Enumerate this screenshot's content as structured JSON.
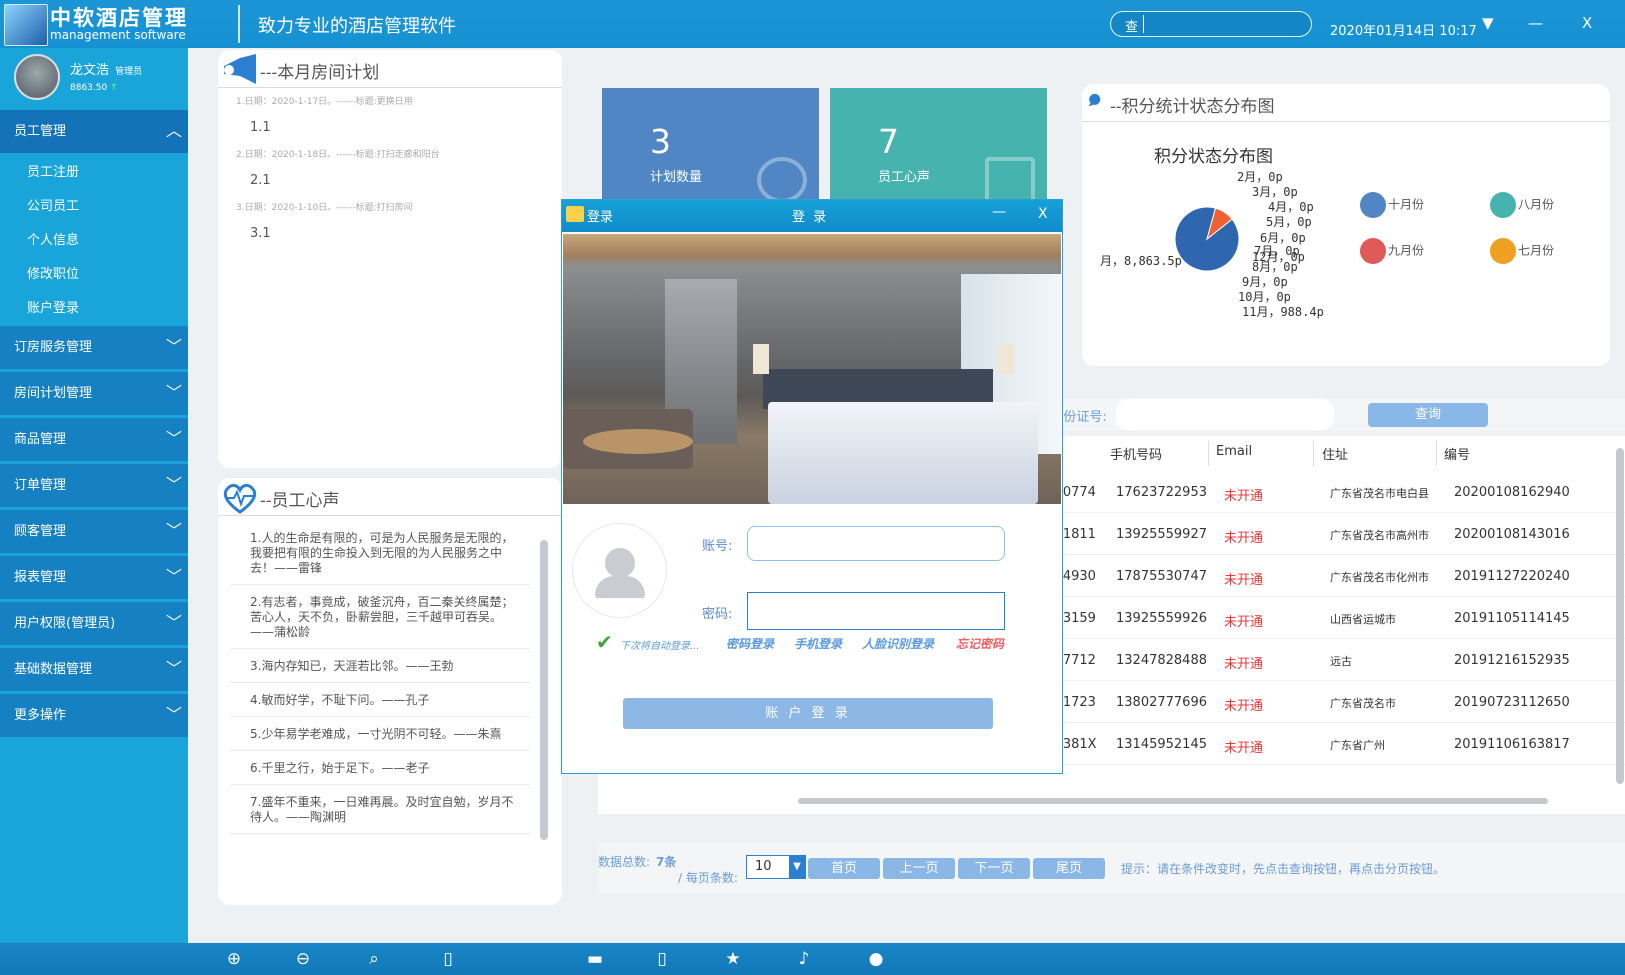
{
  "app": {
    "title": "中软酒店管理",
    "subtitle": "management software",
    "slogan": "致力专业的酒店管理软件"
  },
  "search": {
    "label": "查",
    "placeholder": ""
  },
  "datetime": "2020年01月14日 10:17",
  "window_controls": {
    "dropdown": "▼",
    "minimize": "—",
    "close": "X"
  },
  "user": {
    "name": "龙文浩",
    "role": "管理员",
    "balance": "8863.50",
    "trend": "↑"
  },
  "menu": [
    {
      "label": "员工管理",
      "open": true,
      "children": [
        "员工注册",
        "公司员工",
        "个人信息",
        "修改职位",
        "账户登录"
      ]
    },
    {
      "label": "订房服务管理"
    },
    {
      "label": "房间计划管理"
    },
    {
      "label": "商品管理"
    },
    {
      "label": "订单管理"
    },
    {
      "label": "顾客管理"
    },
    {
      "label": "报表管理"
    },
    {
      "label": "用户权限(管理员)"
    },
    {
      "label": "基础数据管理"
    },
    {
      "label": "更多操作"
    }
  ],
  "plan": {
    "title": "---本月房间计划",
    "items": [
      {
        "date": "1.日期：2020-1-17日。------标题:更换日用",
        "value": "1.1"
      },
      {
        "date": "2.日期：2020-1-18日。------标题:打扫走廊和阳台",
        "value": "2.1"
      },
      {
        "date": "3.日期：2020-1-10日。------标题:打扫房间",
        "value": "3.1"
      }
    ]
  },
  "stats": [
    {
      "number": "3",
      "label": "计划数量",
      "color": "#4f86c3"
    },
    {
      "number": "7",
      "label": "员工心声",
      "color": "#46b3ae"
    }
  ],
  "voice": {
    "title": "--员工心声",
    "items": [
      "1.人的生命是有限的，可是为人民服务是无限的，我要把有限的生命投入到无限的为人民服务之中去！——雷锋",
      "2.有志者，事竟成，破釜沉舟，百二秦关终属楚；苦心人，天不负，卧薪尝胆，三千越甲可吞吴。——蒲松龄",
      "3.海内存知已，天涯若比邻。——王勃",
      "4.敏而好学，不耻下问。——孔子",
      "5.少年易学老难成，一寸光阴不可轻。——朱熹",
      "6.千里之行，始于足下。——老子",
      "7.盛年不重来，一日难再晨。及时宜自勉，岁月不待人。——陶渊明"
    ]
  },
  "chart": {
    "header": "--积分统计状态分布图",
    "title": "积分状态分布图",
    "legend": [
      {
        "name": "十月份",
        "color": "#4f86c3"
      },
      {
        "name": "八月份",
        "color": "#46b3ae"
      },
      {
        "name": "九月份",
        "color": "#e05a5a"
      },
      {
        "name": "七月份",
        "color": "#f0a020"
      }
    ],
    "slice_labels": [
      "2月，0p",
      "3月，0p",
      "4月，0p",
      "5月，0p",
      "6月，0p",
      "7月，0p",
      "12月，0p",
      "8月，0p",
      "9月，0p",
      "10月，0p",
      "11月，988.4p",
      "月，8,863.5p"
    ]
  },
  "chart_data": {
    "type": "pie",
    "title": "积分状态分布图",
    "categories": [
      "月",
      "2月",
      "3月",
      "4月",
      "5月",
      "6月",
      "7月",
      "8月",
      "9月",
      "10月",
      "11月",
      "12月"
    ],
    "values": [
      8863.5,
      0,
      0,
      0,
      0,
      0,
      0,
      0,
      0,
      0,
      988.4,
      0
    ]
  },
  "filter": {
    "id_label": "|身份证号:",
    "id_value": "",
    "query": "查询"
  },
  "table": {
    "headers": [
      "手机号码",
      "Email",
      "住址",
      "编号"
    ],
    "rows": [
      {
        "id_tail": "9300774",
        "phone": "17623722953",
        "email": "未开通",
        "addr": "广东省茂名市电白县",
        "no": "20200108162940"
      },
      {
        "id_tail": "7181811",
        "phone": "13925559927",
        "email": "未开通",
        "addr": "广东省茂名市高州市",
        "no": "20200108143016"
      },
      {
        "id_tail": "2284930",
        "phone": "17875530747",
        "email": "未开通",
        "addr": "广东省茂名市化州市",
        "no": "20191127220240"
      },
      {
        "id_tail": "1193159",
        "phone": "13925559926",
        "email": "未开通",
        "addr": "山西省运城市",
        "no": "20191105114145"
      },
      {
        "id_tail": "1247712",
        "phone": "13247828488",
        "email": "未开通",
        "addr": "远古",
        "no": "20191216152935"
      },
      {
        "id_tail": "2081723",
        "phone": "13802777696",
        "email": "未开通",
        "addr": "广东省茂名市",
        "no": "20190723112650"
      },
      {
        "id_tail": "206381X",
        "phone": "13145952145",
        "email": "未开通",
        "addr": "广东省广州",
        "no": "20191106163817"
      }
    ]
  },
  "pager": {
    "total_label": "数据总数:",
    "total": "7条",
    "per_page_label": "/ 每页条数:",
    "per_page": "10",
    "first": "首页",
    "prev": "上一页",
    "next": "下一页",
    "last": "尾页",
    "hint": "提示：请在条件改变时，先点击查询按钮，再点击分页按钮。"
  },
  "dialog": {
    "title_left": "登录",
    "title_center": "登 录",
    "minimize": "—",
    "close": "X",
    "account_label": "账号:",
    "password_label": "密码:",
    "account_value": "",
    "password_value": "",
    "auto_login": "下次将自动登录...",
    "links": [
      "密码登录",
      "手机登录",
      "人脸识别登录"
    ],
    "forgot": "忘记密码",
    "submit": "账 户 登 录"
  },
  "bottom_icons": [
    "zoom-in-icon",
    "zoom-out-icon",
    "search-icon",
    "phone-icon",
    "gamepad-icon",
    "tablet-icon",
    "star-icon",
    "microphone-icon",
    "globe-icon"
  ]
}
